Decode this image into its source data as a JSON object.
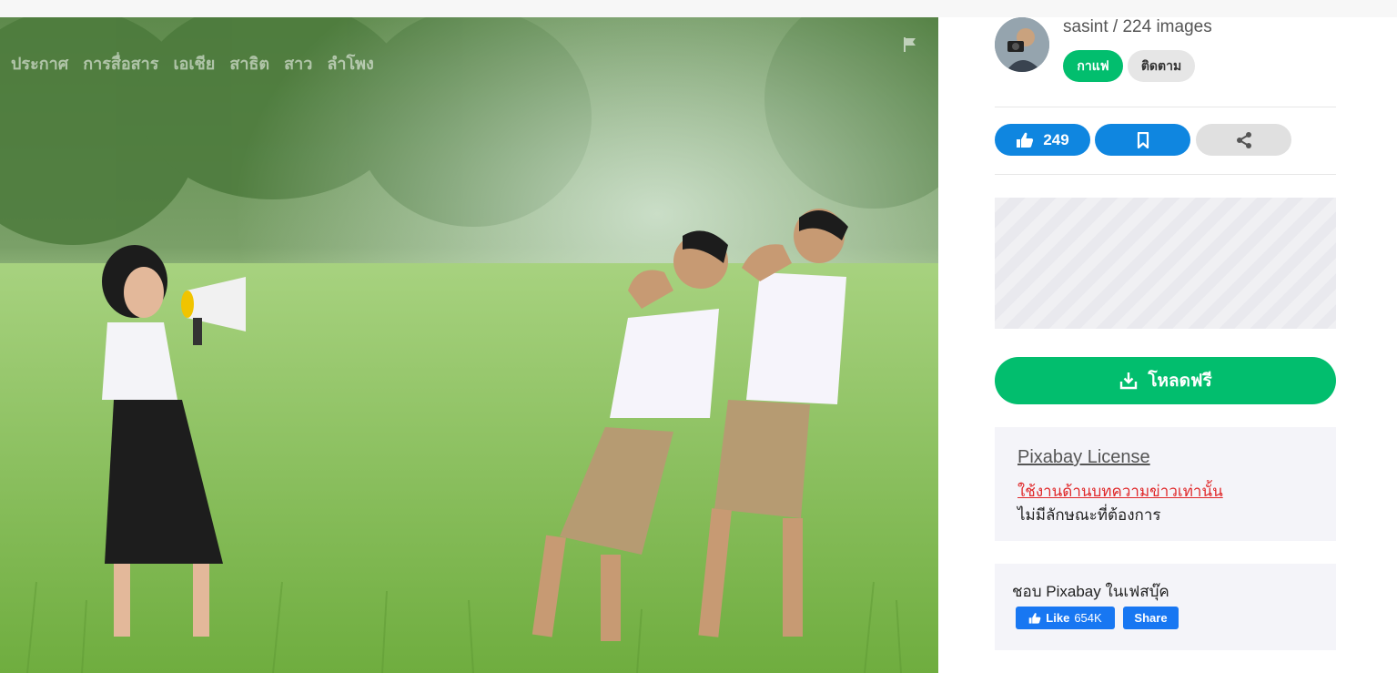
{
  "photo": {
    "tags": [
      "ประกาศ",
      "การสื่อสาร",
      "เอเชีย",
      "สาธิต",
      "สาว",
      "ลำโพง"
    ],
    "flag_icon": "flag-icon",
    "description_icon": "photo"
  },
  "author": {
    "name_line": "sasint / 224 images",
    "coffee_label": "กาแฟ",
    "follow_label": "ติดตาม"
  },
  "actions": {
    "like_count": "249",
    "like_icon": "thumbs-up-icon",
    "save_icon": "bookmark-icon",
    "share_icon": "share-icon"
  },
  "download": {
    "label": "โหลดฟรี",
    "icon": "download-icon"
  },
  "license": {
    "title": "Pixabay License",
    "link": "ใช้งานด้านบทความข่าวเท่านั้น",
    "note": "ไม่มีลักษณะที่ต้องการ"
  },
  "facebook": {
    "text": "ชอบ Pixabay ในเฟสบุ๊ค",
    "like_label": "Like",
    "like_count": "654K",
    "share_label": "Share"
  },
  "colors": {
    "green": "#02be6e",
    "blue": "#0f86e0",
    "facebook": "#1877f2",
    "license_link": "#e0282a"
  }
}
